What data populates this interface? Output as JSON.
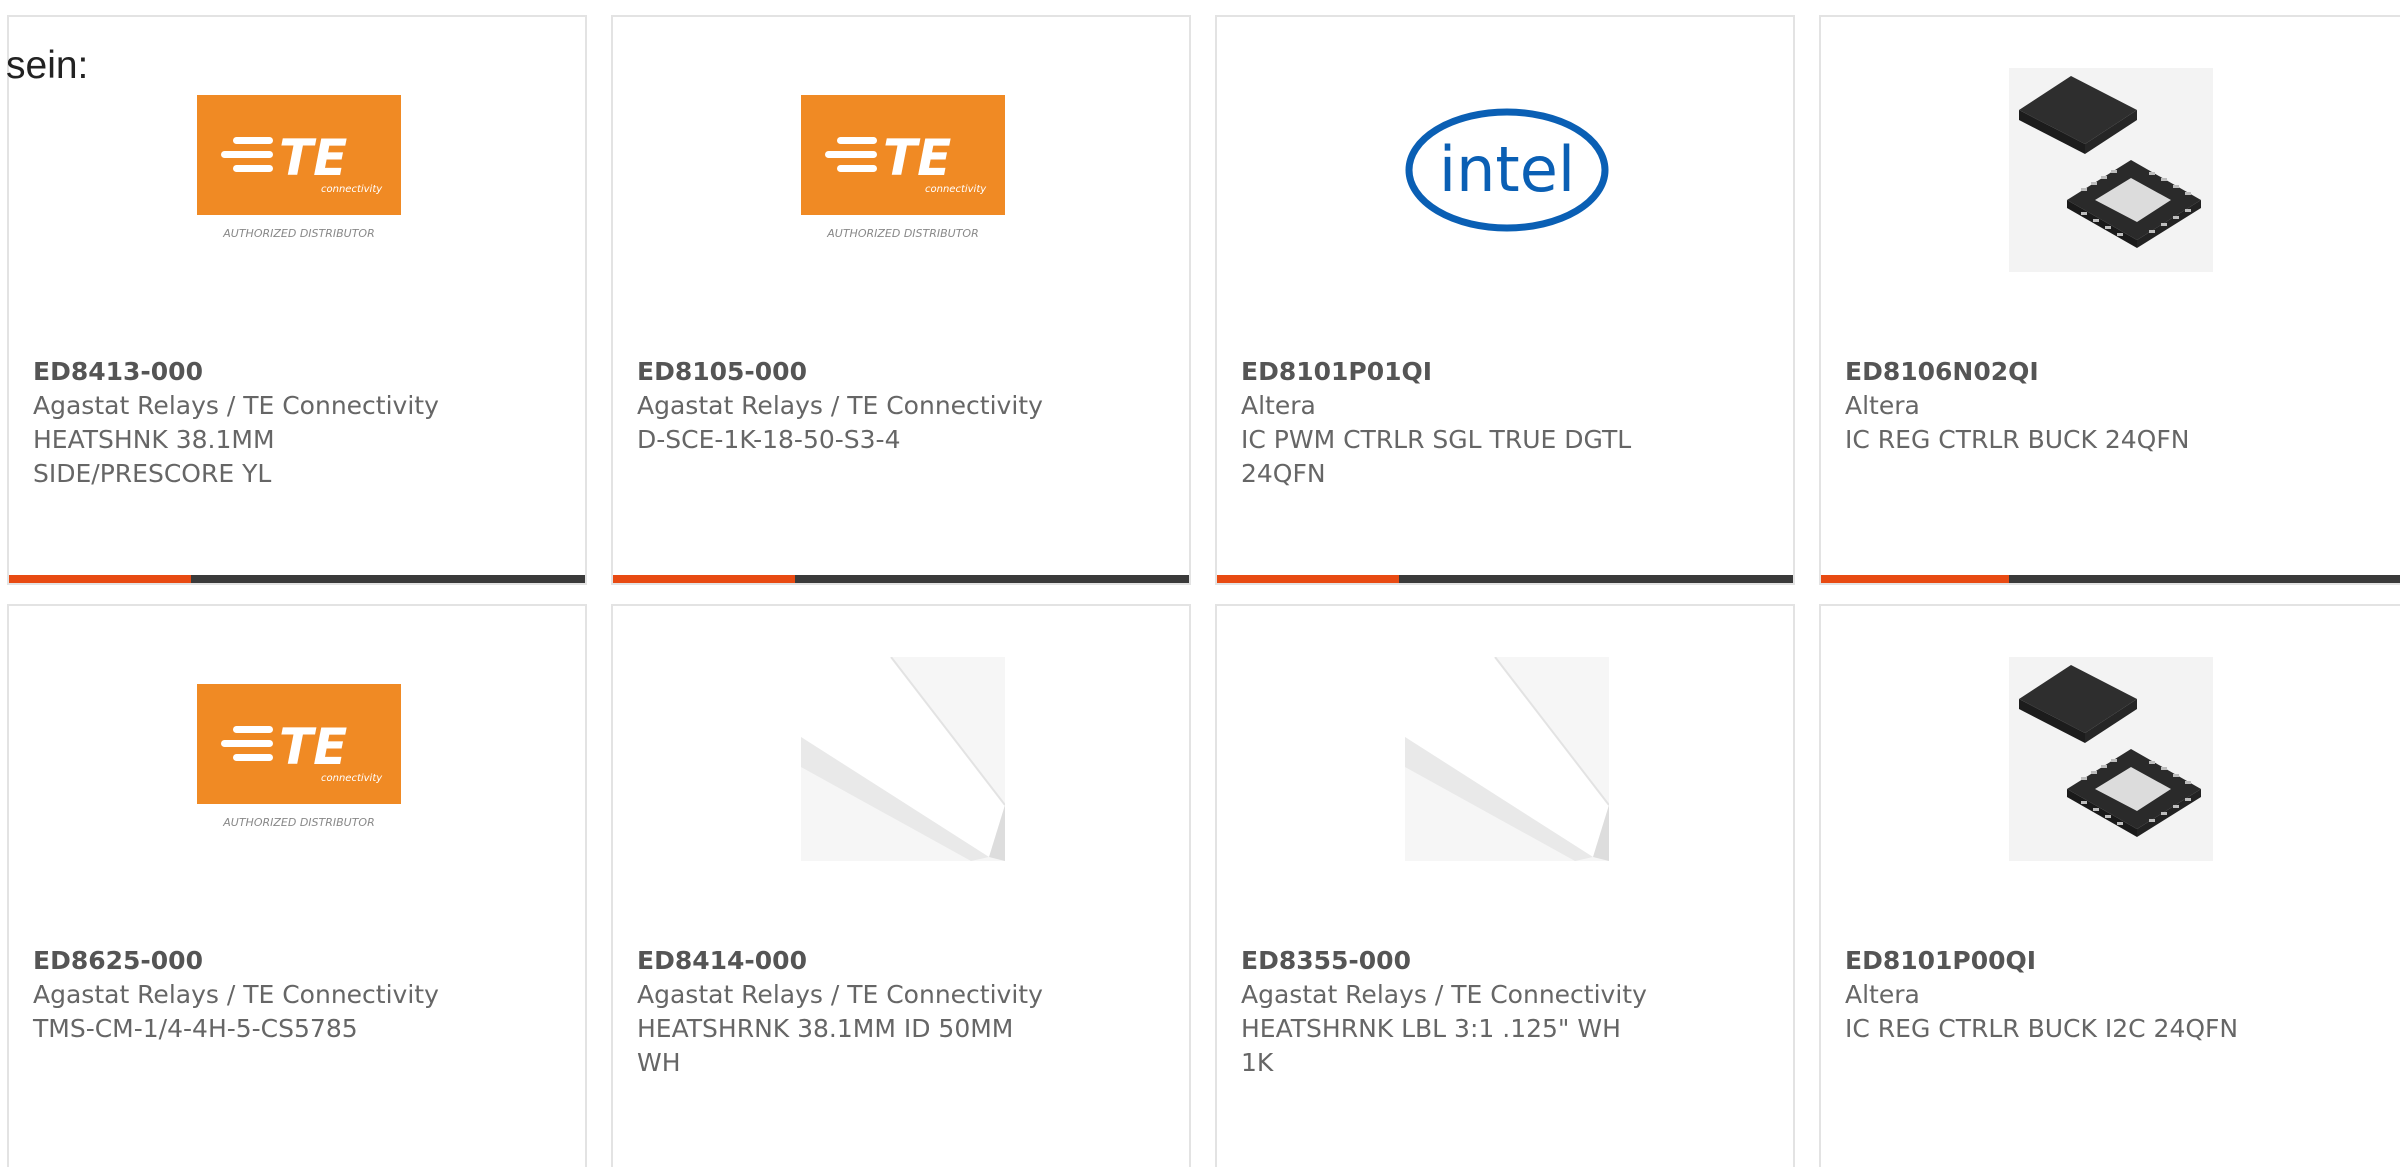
{
  "page": {
    "lead_text": "sein:"
  },
  "colors": {
    "accent": "#e84a12",
    "bar_track": "#3a3a3a",
    "te_orange": "#f08a24",
    "intel_blue": "#0a5fb4"
  },
  "logos": {
    "te": {
      "wordmark": "TE",
      "tagline": "connectivity",
      "caption": "AUTHORIZED DISTRIBUTOR"
    },
    "intel": {
      "wordmark": "intel"
    }
  },
  "products": [
    {
      "part_number": "ED8413-000",
      "manufacturer": "Agastat Relays / TE Connectivity",
      "description": "HEATSHNK 38.1MM SIDE/PRESCORE YL",
      "image": "te-logo",
      "bar_fill": 0.316
    },
    {
      "part_number": "ED8105-000",
      "manufacturer": "Agastat Relays / TE Connectivity",
      "description": "D-SCE-1K-18-50-S3-4",
      "image": "te-logo",
      "bar_fill": 0.316
    },
    {
      "part_number": "ED8101P01QI",
      "manufacturer": "Altera",
      "description": "IC PWM CTRLR SGL TRUE DGTL 24QFN",
      "image": "intel-logo",
      "bar_fill": 0.316
    },
    {
      "part_number": "ED8106N02QI",
      "manufacturer": "Altera",
      "description": "IC REG CTRLR BUCK 24QFN",
      "image": "qfn-chip",
      "bar_fill": 0.316
    },
    {
      "part_number": "ED8625-000",
      "manufacturer": "Agastat Relays / TE Connectivity",
      "description": "TMS-CM-1/4-4H-5-CS5785",
      "image": "te-logo"
    },
    {
      "part_number": "ED8414-000",
      "manufacturer": "Agastat Relays / TE Connectivity",
      "description": "HEATSHRNK 38.1MM ID 50MM WH",
      "image": "heatshrink-tube"
    },
    {
      "part_number": "ED8355-000",
      "manufacturer": "Agastat Relays / TE Connectivity",
      "description": "HEATSHRNK LBL 3:1 .125\" WH 1K",
      "image": "heatshrink-tube"
    },
    {
      "part_number": "ED8101P00QI",
      "manufacturer": "Altera",
      "description": "IC REG CTRLR BUCK I2C 24QFN",
      "image": "qfn-chip"
    }
  ]
}
